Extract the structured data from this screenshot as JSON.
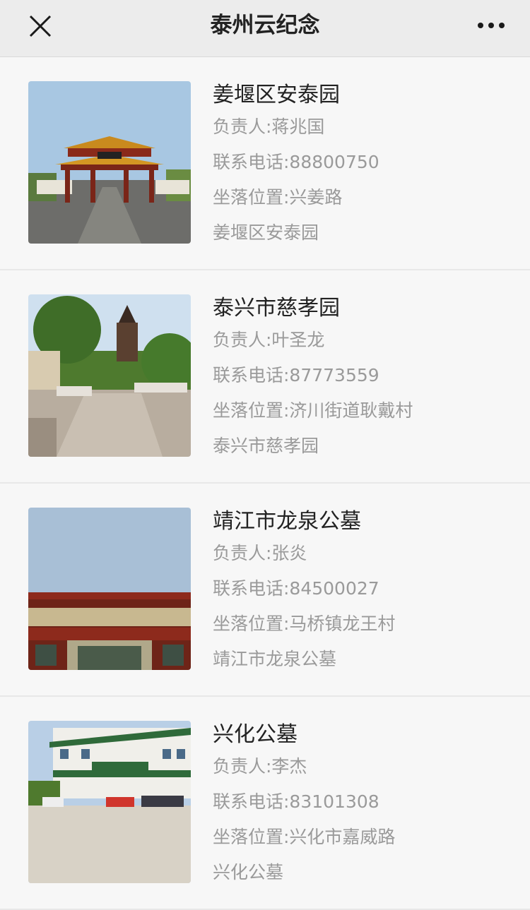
{
  "header": {
    "title": "泰州云纪念"
  },
  "icons": {
    "close": "close-icon",
    "more": "more-icon"
  },
  "entries": [
    {
      "name": "姜堰区安泰园",
      "manager": "负责人:蒋兆国",
      "phone": "联系电话:88800750",
      "location": "坐落位置:兴姜路",
      "desc": "姜堰区安泰园"
    },
    {
      "name": "泰兴市慈孝园",
      "manager": "负责人:叶圣龙",
      "phone": "联系电话:87773559",
      "location": "坐落位置:济川街道耿戴村",
      "desc": "泰兴市慈孝园"
    },
    {
      "name": "靖江市龙泉公墓",
      "manager": "负责人:张炎",
      "phone": "联系电话:84500027",
      "location": "坐落位置:马桥镇龙王村",
      "desc": "靖江市龙泉公墓"
    },
    {
      "name": "兴化公墓",
      "manager": "负责人:李杰",
      "phone": "联系电话:83101308",
      "location": "坐落位置:兴化市嘉威路",
      "desc": "兴化公墓"
    }
  ]
}
